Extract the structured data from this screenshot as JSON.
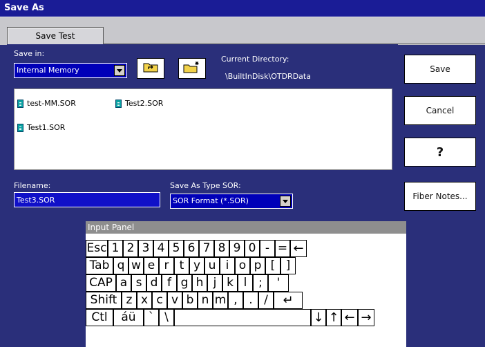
{
  "window": {
    "title": "Save As"
  },
  "tabs": [
    {
      "label": "Save Test"
    }
  ],
  "save_in": {
    "label": "Save in:",
    "value": "Internal Memory"
  },
  "current_directory": {
    "label": "Current Directory:",
    "path": "\\BuiltInDisk\\OTDRData"
  },
  "files": [
    "test-MM.SOR",
    "Test2.SOR",
    "Test1.SOR"
  ],
  "filename": {
    "label": "Filename:",
    "value": "Test3.SOR"
  },
  "save_as_type": {
    "label": "Save As Type SOR:",
    "value": "SOR Format (*.SOR)"
  },
  "buttons": {
    "save": "Save",
    "cancel": "Cancel",
    "help": "?",
    "fiber_notes": "Fiber Notes..."
  },
  "input_panel": {
    "title": "Input Panel",
    "rows": [
      [
        "Esc",
        "1",
        "2",
        "3",
        "4",
        "5",
        "6",
        "7",
        "8",
        "9",
        "0",
        "-",
        "=",
        "←"
      ],
      [
        "Tab",
        "q",
        "w",
        "e",
        "r",
        "t",
        "y",
        "u",
        "i",
        "o",
        "p",
        "[",
        "]"
      ],
      [
        "CAP",
        "a",
        "s",
        "d",
        "f",
        "g",
        "h",
        "j",
        "k",
        "l",
        ";",
        "'"
      ],
      [
        "Shift",
        "z",
        "x",
        "c",
        "v",
        "b",
        "n",
        "m",
        ",",
        ".",
        "/",
        "↵"
      ],
      [
        "Ctl",
        "áü",
        "`",
        "\\",
        "",
        "↓",
        "↑",
        "←",
        "→"
      ]
    ]
  },
  "colors": {
    "title_bar": "#1a1c96",
    "background": "#2a2f7a",
    "field": "#1010c8"
  },
  "icons": {
    "up_folder": "up-folder-icon",
    "new_folder": "new-folder-icon",
    "file": "sor-file-icon",
    "dropdown": "chevron-down-icon"
  }
}
